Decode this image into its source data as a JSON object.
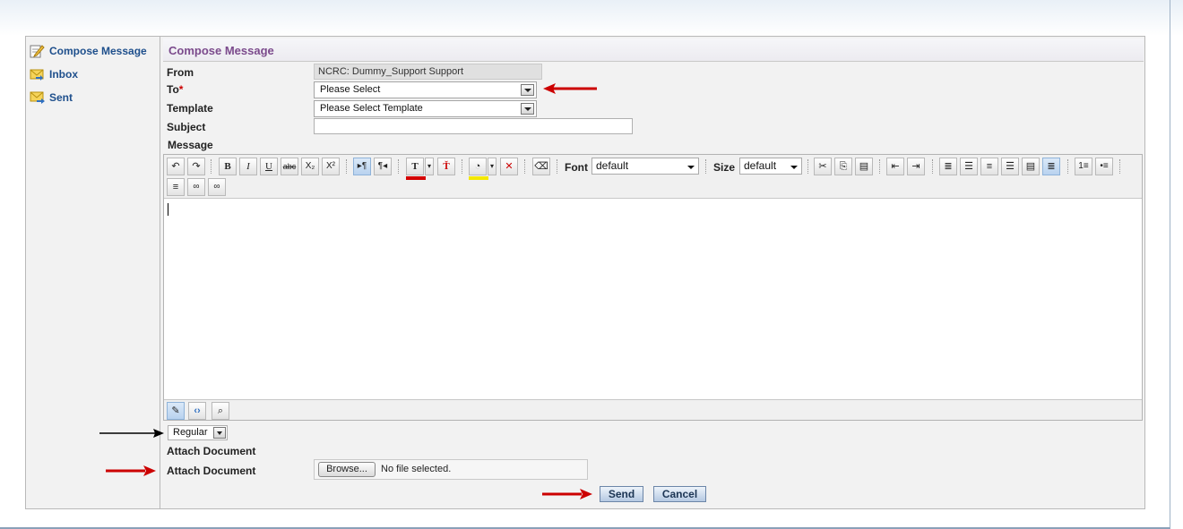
{
  "sidebar": {
    "items": [
      {
        "label": "Compose Message",
        "icon": "compose-icon"
      },
      {
        "label": "Inbox",
        "icon": "inbox-icon"
      },
      {
        "label": "Sent",
        "icon": "sent-icon"
      }
    ]
  },
  "form": {
    "title": "Compose Message",
    "from_label": "From",
    "from_value": "NCRC: Dummy_Support Support",
    "to_label": "To",
    "to_required": "*",
    "to_value": "Please Select",
    "template_label": "Template",
    "template_value": "Please Select Template",
    "subject_label": "Subject",
    "subject_value": "",
    "message_label": "Message"
  },
  "editor": {
    "font_label": "Font",
    "font_value": "default",
    "size_label": "Size",
    "size_value": "default",
    "buttons": {
      "bold": "B",
      "italic": "I",
      "underline": "U",
      "strike": "abc",
      "subscript": "X₂",
      "superscript": "X²",
      "text_color": "T"
    },
    "text_color_swatch": "#d40000",
    "highlight_swatch": "#f4e800"
  },
  "priority": {
    "value": "Regular"
  },
  "attachments": {
    "label1": "Attach Document",
    "label2": "Attach Document",
    "browse_label": "Browse...",
    "file_status": "No file selected."
  },
  "actions": {
    "send_label": "Send",
    "cancel_label": "Cancel"
  },
  "colors": {
    "arrow_red": "#cc0000",
    "title_purple": "#7b4a8c",
    "link_blue": "#1e4f8c"
  }
}
